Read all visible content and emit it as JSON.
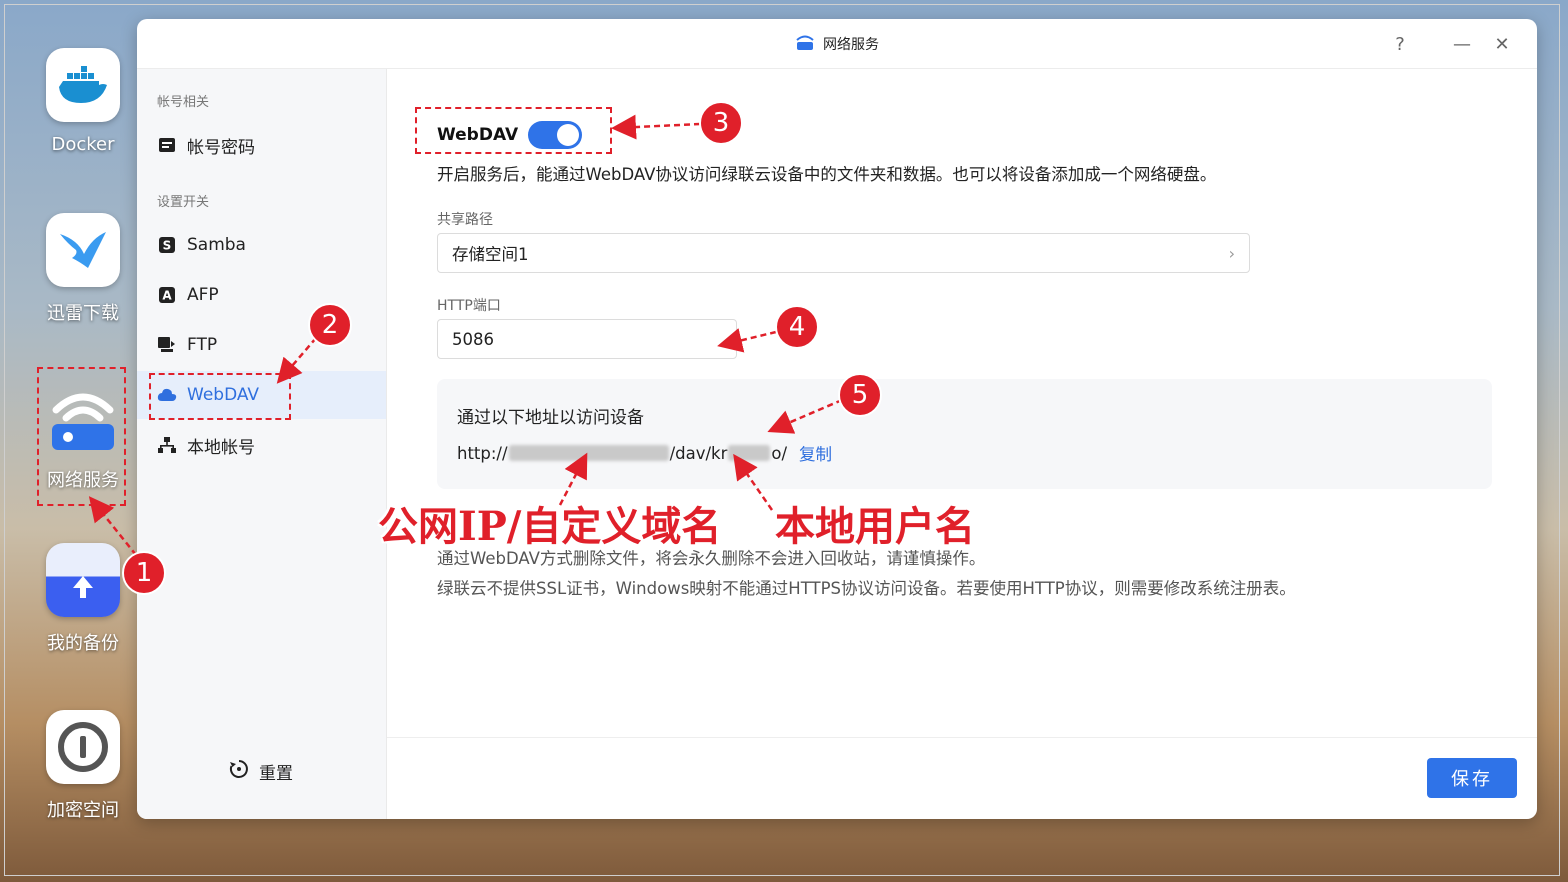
{
  "dock": {
    "items": [
      {
        "label": "Docker",
        "icon": "docker-icon"
      },
      {
        "label": "迅雷下载",
        "icon": "thunder-bird-icon"
      },
      {
        "label": "网络服务",
        "icon": "network-service-icon"
      },
      {
        "label": "我的备份",
        "icon": "backup-icon"
      },
      {
        "label": "加密空间",
        "icon": "vault-icon"
      }
    ]
  },
  "window": {
    "title": "网络服务",
    "help": "?",
    "minimize": "—",
    "close": "✕"
  },
  "sidebar": {
    "section_account": "帐号相关",
    "account_items": [
      {
        "label": "帐号密码",
        "icon": "id-card-icon"
      }
    ],
    "section_settings": "设置开关",
    "settings_items": [
      {
        "label": "Samba",
        "icon": "samba-icon"
      },
      {
        "label": "AFP",
        "icon": "afp-icon"
      },
      {
        "label": "FTP",
        "icon": "ftp-icon"
      },
      {
        "label": "WebDAV",
        "icon": "cloud-icon",
        "active": true
      },
      {
        "label": "本地帐号",
        "icon": "org-tree-icon"
      }
    ],
    "reset_label": "重置"
  },
  "main": {
    "webdav_label": "WebDAV",
    "webdav_enabled": true,
    "description": "开启服务后，能通过WebDAV协议访问绿联云设备中的文件夹和数据。也可以将设备添加成一个网络硬盘。",
    "share_path_label": "共享路径",
    "share_path_value": "存储空间1",
    "http_port_label": "HTTP端口",
    "http_port_value": "5086",
    "address_title": "通过以下地址以访问设备",
    "url_prefix": "http://",
    "url_mid": "/dav/kr",
    "url_suffix": "o/",
    "copy_label": "复制",
    "notes": [
      "通过WebDAV方式删除文件，将会永久删除不会进入回收站，请谨慎操作。",
      "绿联云不提供SSL证书，Windows映射不能通过HTTPS协议访问设备。若要使用HTTP协议，则需要修改系统注册表。"
    ],
    "save_label": "保存"
  },
  "annotations": {
    "badges": [
      "1",
      "2",
      "3",
      "4",
      "5"
    ],
    "caption_public_ip": "公网IP/自定义域名",
    "caption_local_user": "本地用户名",
    "color": "#e0202a"
  }
}
